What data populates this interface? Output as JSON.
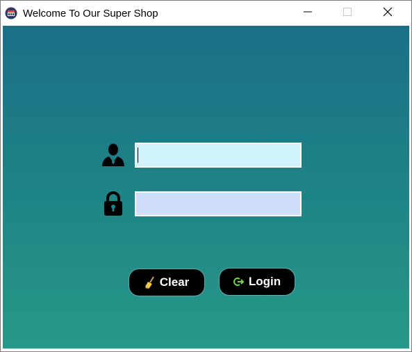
{
  "window": {
    "title": "Welcome To Our Super Shop",
    "app_icon": "shop-icon",
    "controls": {
      "minimize": "minimize-icon",
      "maximize": "maximize-icon",
      "close": "close-icon"
    }
  },
  "form": {
    "username": {
      "icon": "user-icon",
      "value": "",
      "placeholder": ""
    },
    "password": {
      "icon": "lock-icon",
      "value": "",
      "placeholder": ""
    }
  },
  "buttons": {
    "clear": {
      "label": "Clear",
      "icon": "broom-icon"
    },
    "login": {
      "label": "Login",
      "icon": "login-icon"
    }
  },
  "colors": {
    "gradient_top": "#1a6f86",
    "gradient_bottom": "#289887",
    "username_bg": "#cdf4fb",
    "password_bg": "#d0defb",
    "button_bg": "#000000",
    "login_icon": "#7fd14a"
  }
}
